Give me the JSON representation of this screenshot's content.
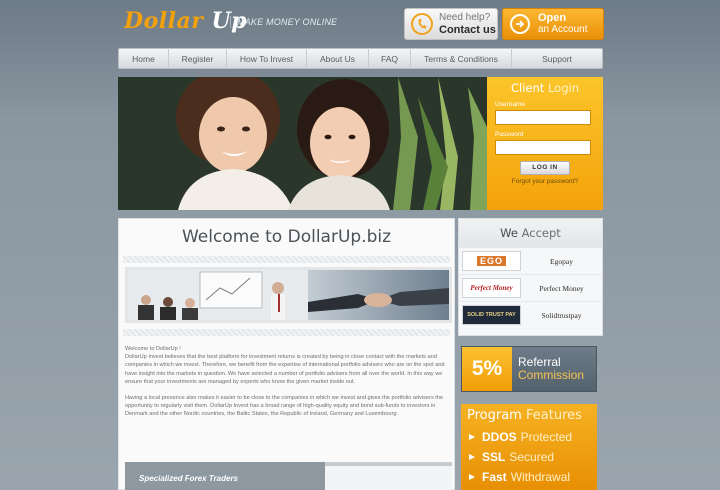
{
  "header": {
    "logo_part1": "Dollar",
    "logo_part2": "Up",
    "tagline": "MAKE MONEY ONLINE",
    "help_line1": "Need help?",
    "help_line2": "Contact us",
    "open_line1": "Open",
    "open_line2": "an Account"
  },
  "nav": {
    "items": [
      "Home",
      "Register",
      "How To Invest",
      "About Us",
      "FAQ",
      "Terms & Conditions",
      "Support"
    ]
  },
  "login": {
    "title_part1": "Client",
    "title_part2": "Login",
    "username_label": "Username",
    "password_label": "Password",
    "button": "LOG IN",
    "forgot": "Forgot your password?"
  },
  "main": {
    "title": "Welcome to DollarUp.biz",
    "greeting": "Welcome to DollarUp !",
    "paragraph1": "DollarUp Invest believes that the best platform for investment returns is created by being in close contact with the markets and companies in which we invest. Therefore, we benefit from the expertise of international portfolio advisers who are on the spot and have insight into the markets in question. We have selected a number of portfolio advisers from all over the world. In this way we ensure that your investments are managed by experts who know the given market inside out.",
    "paragraph2": "Having a local presence also makes it easier to be close to the companies in which we invest and gives the portfolio advisers the opportunity to regularly visit them. DollarUp Invest has a broad range of high-quality equity and bond sub-funds to investors in Denmark and the other Nordic countries, the Baltic States, the Republic of Ireland, Germany and Luxembourg.",
    "bottom_banner_text": "Specialized Forex Traders"
  },
  "accept": {
    "title_part1": "We",
    "title_part2": "Accept",
    "processors": [
      {
        "logo": "EGO",
        "name": "Egopay"
      },
      {
        "logo": "Perfect Money",
        "name": "Perfect Money"
      },
      {
        "logo": "SOLID TRUST PAY",
        "name": "Solidtrustpay"
      }
    ]
  },
  "referral": {
    "percent": "5%",
    "line1": "Referral",
    "line2": "Commission"
  },
  "features": {
    "title_part1": "Program",
    "title_part2": "Features",
    "items": [
      {
        "key": "DDOS",
        "value": "Protected"
      },
      {
        "key": "SSL",
        "value": "Secured"
      },
      {
        "key": "Fast",
        "value": "Withdrawal"
      }
    ]
  },
  "colors": {
    "accent_orange": "#f4a10c",
    "page_bg": "#8a96a0",
    "panel_bg": "#fafafa"
  }
}
